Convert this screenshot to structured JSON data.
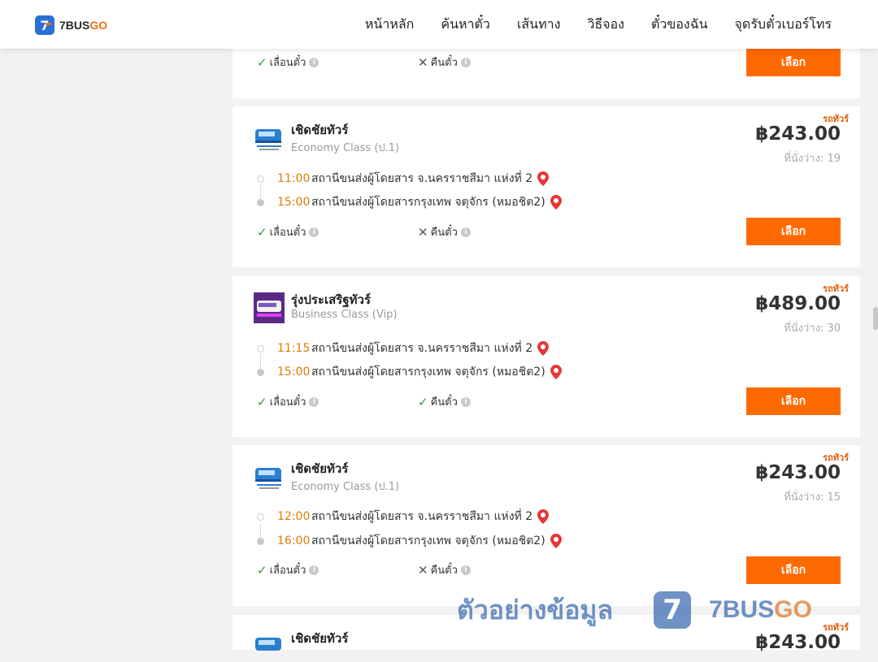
{
  "brand": {
    "name_a": "7BUS",
    "name_b": "GO",
    "badge": "7"
  },
  "nav": [
    "หน้าหลัก",
    "ค้นหาตั๋ว",
    "เส้นทาง",
    "วิธีจอง",
    "ตั๋วของฉัน",
    "จุดรับตั๋วเบอร์โทร"
  ],
  "policy_labels": {
    "change": "เลื่อนตั๋ว",
    "refund": "คืนตั๋ว"
  },
  "select_label": "เลือก",
  "bus_tag": "รถทัวร์",
  "cards": [
    {
      "change_allowed": true,
      "refund_allowed": false
    },
    {
      "operator": "เชิดชัยทัวร์",
      "class": "Economy Class (ป.1)",
      "price": "฿243.00",
      "seats": "ที่นั่งว่าง: 19",
      "depart_time": "11:00",
      "depart_place": "สถานีขนส่งผู้โดยสาร จ.นครราชสีมา แห่งที่ 2",
      "arrive_time": "15:00",
      "arrive_place": "สถานีขนส่งผู้โดยสารกรุงเทพ จตุจักร (หมอชิต2)",
      "change_allowed": true,
      "refund_allowed": false
    },
    {
      "operator": "รุ่งประเสริฐทัวร์",
      "class": "Business Class (Vip)",
      "price": "฿489.00",
      "seats": "ที่นั่งว่าง: 30",
      "depart_time": "11:15",
      "depart_place": "สถานีขนส่งผู้โดยสาร จ.นครราชสีมา แห่งที่ 2",
      "arrive_time": "15:00",
      "arrive_place": "สถานีขนส่งผู้โดยสารกรุงเทพ จตุจักร (หมอชิต2)",
      "change_allowed": true,
      "refund_allowed": true
    },
    {
      "operator": "เชิดชัยทัวร์",
      "class": "Economy Class (ป.1)",
      "price": "฿243.00",
      "seats": "ที่นั่งว่าง: 15",
      "depart_time": "12:00",
      "depart_place": "สถานีขนส่งผู้โดยสาร จ.นครราชสีมา แห่งที่ 2",
      "arrive_time": "16:00",
      "arrive_place": "สถานีขนส่งผู้โดยสารกรุงเทพ จตุจักร (หมอชิต2)",
      "change_allowed": true,
      "refund_allowed": false
    },
    {
      "operator": "เชิดชัยทัวร์",
      "price": "฿243.00"
    }
  ],
  "watermark": {
    "text": "ตัวอย่างข้อมูล",
    "brand_a": "7BUS",
    "brand_b": "GO",
    "badge": "7"
  },
  "colors": {
    "accent": "#ff6a00",
    "brand_blue": "#2a6fd6",
    "time": "#e07b00",
    "ok": "#2e9e3e"
  }
}
